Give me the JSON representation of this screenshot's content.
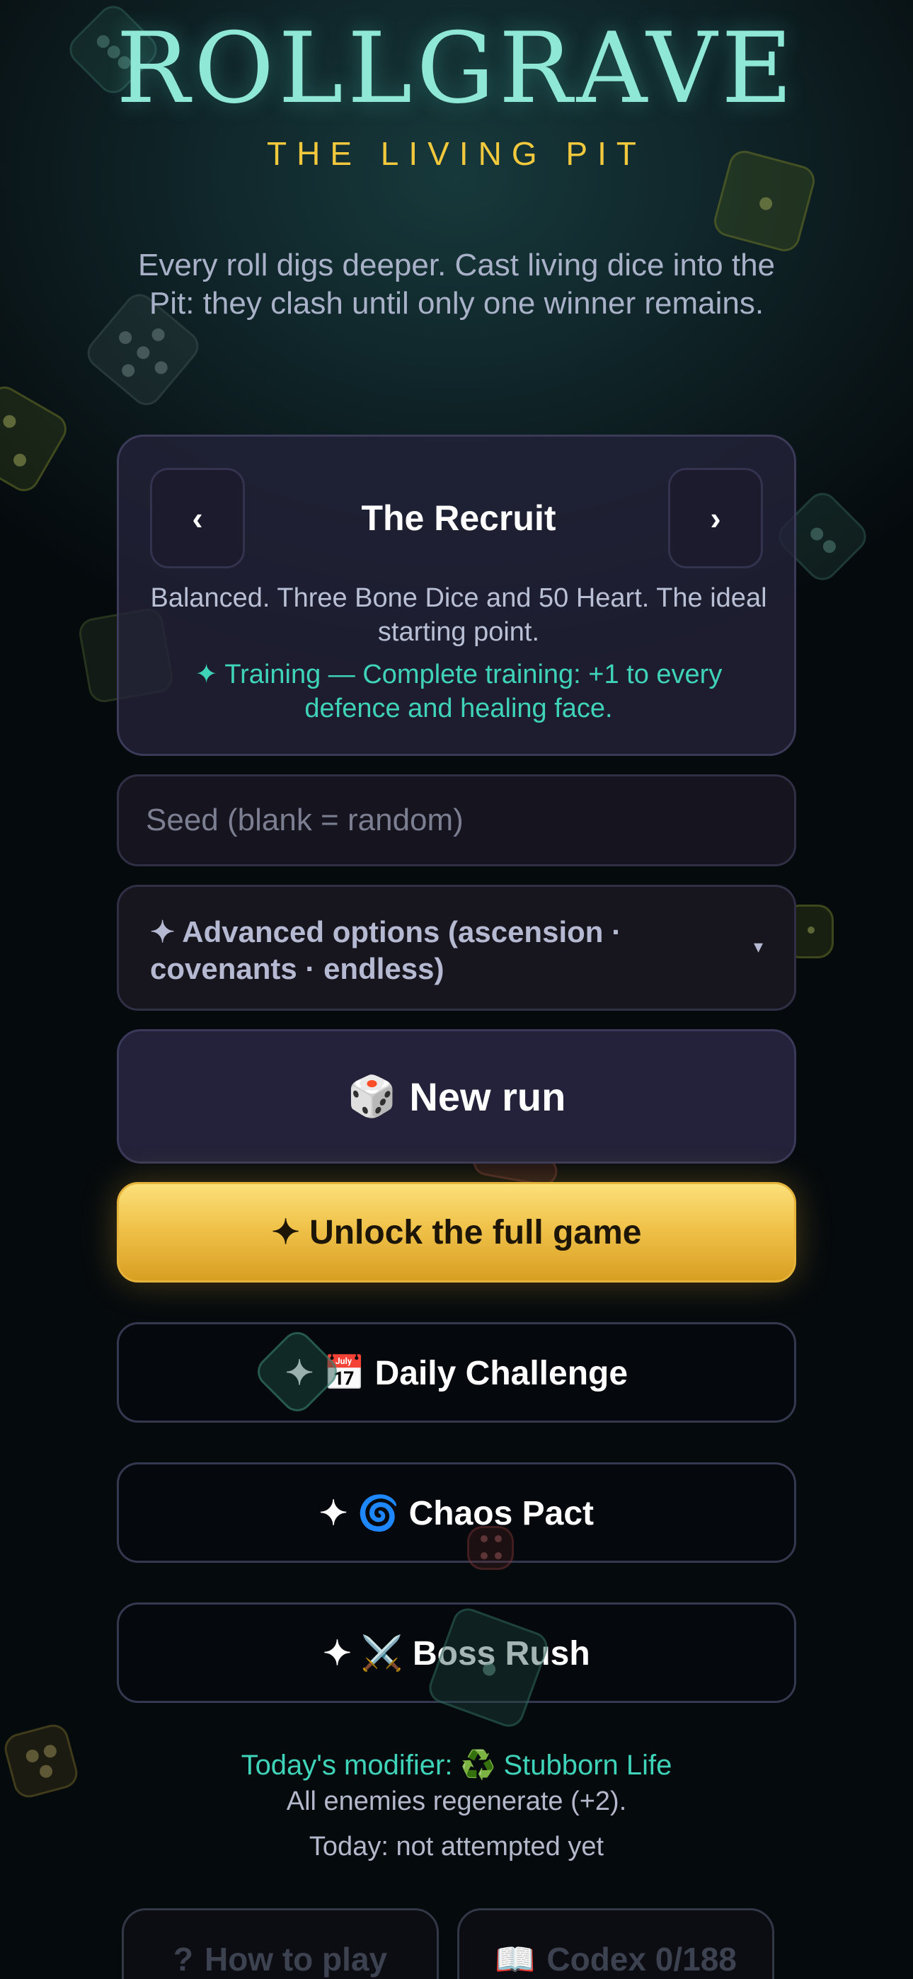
{
  "header": {
    "title": "ROLLGRAVE",
    "subtitle": "THE LIVING PIT",
    "tagline": "Every roll digs deeper. Cast living dice into the Pit: they clash until only one winner remains."
  },
  "hero_selector": {
    "prev_label": "‹",
    "next_label": "›",
    "name": "The Recruit",
    "description": "Balanced. Three Bone Dice and 50 Heart. The ideal starting point.",
    "perk": "✦ Training — Complete training: +1 to every defence and healing face."
  },
  "seed": {
    "placeholder": "Seed (blank = random)",
    "value": ""
  },
  "advanced": {
    "label": "✦ Advanced options (ascension · covenants · endless)",
    "caret": "▾"
  },
  "buttons": {
    "new_run": {
      "icon": "🎲",
      "label": "New run"
    },
    "unlock": {
      "label": "✦ Unlock the full game"
    },
    "daily": {
      "label": "✦ 📅 Daily Challenge"
    },
    "chaos": {
      "label": "✦ 🌀 Chaos Pact"
    },
    "boss": {
      "label": "✦ ⚔️ Boss Rush"
    },
    "how_to_play": {
      "icon": "?",
      "label": "How to play"
    },
    "codex": {
      "icon": "📖",
      "label": "Codex 0/188"
    }
  },
  "daily_info": {
    "modifier": "Today's modifier: ♻️ Stubborn Life",
    "modifier_desc": "All enemies regenerate (+2).",
    "status": "Today: not attempted yet"
  },
  "colors": {
    "title": "#8fe8d6",
    "subtitle": "#f2c93d",
    "accent_teal": "#3fd3b9",
    "gold_button": "#f0c24a"
  }
}
